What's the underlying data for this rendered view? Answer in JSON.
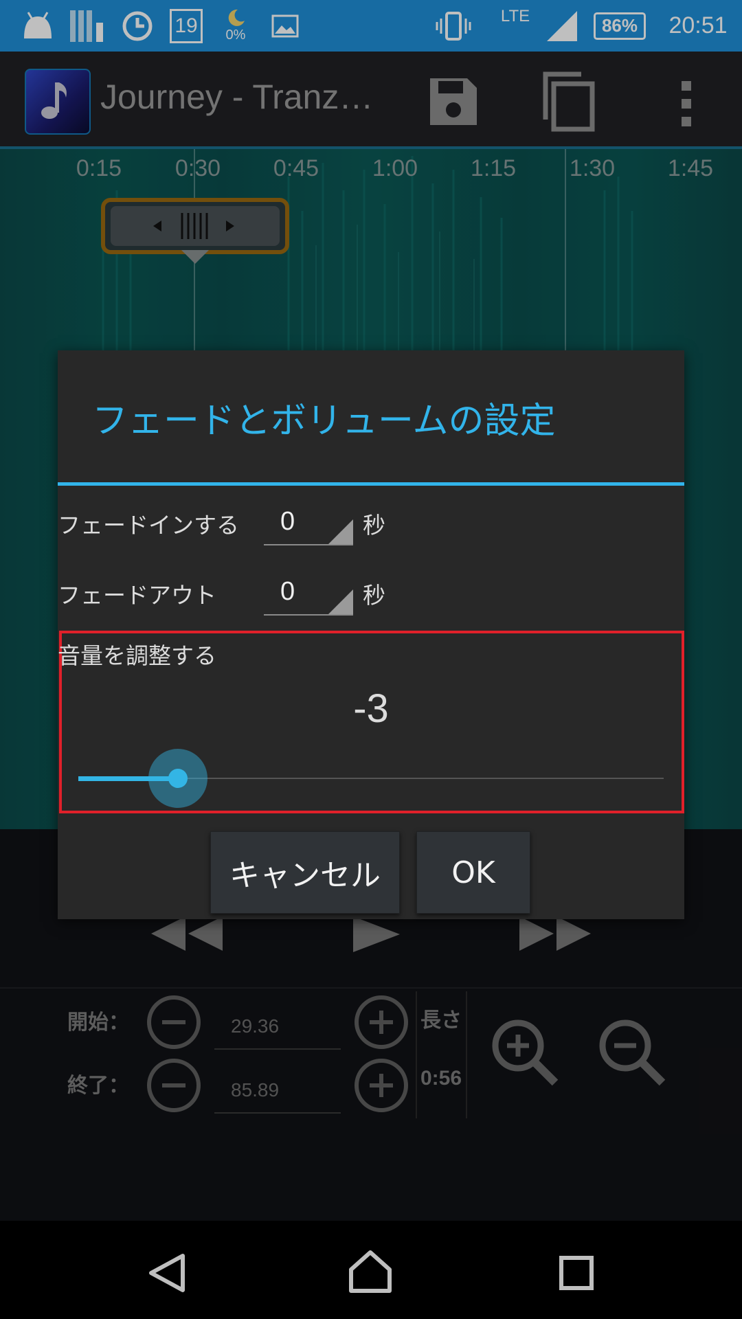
{
  "status_bar": {
    "calendar_day": "19",
    "moon_percent": "0%",
    "network": "LTE",
    "battery": "86%",
    "time": "20:51",
    "icons": [
      "android-icon",
      "storage-icon",
      "clock-icon",
      "calendar-icon",
      "moon-icon",
      "image-icon",
      "vibrate-icon",
      "signal-icon",
      "battery-icon"
    ]
  },
  "app_bar": {
    "title": "Journey - Tranz…",
    "icons": [
      "music-note-icon",
      "save-icon",
      "copy-icon",
      "overflow-menu-icon"
    ]
  },
  "timeline": {
    "ticks": [
      "0:15",
      "0:30",
      "0:45",
      "1:00",
      "1:15",
      "1:30",
      "1:45"
    ]
  },
  "dialog": {
    "title": "フェードとボリュームの設定",
    "fade_in_label": "フェードインする",
    "fade_in_value": "0",
    "fade_out_label": "フェードアウト",
    "fade_out_value": "0",
    "unit": "秒",
    "volume_label": "音量を調整する",
    "volume_value": "-3",
    "volume_slider_fraction": 0.17,
    "cancel_label": "キャンセル",
    "ok_label": "OK",
    "accent_color": "#33b5e5",
    "highlight_color": "#e0202a"
  },
  "controls": {
    "start_label": "開始：",
    "start_value": "29.36",
    "end_label": "終了：",
    "end_value": "85.89",
    "length_label": "長さ",
    "length_value": "0:56",
    "icons": [
      "rewind-icon",
      "play-icon",
      "fast-forward-icon",
      "zoom-in-icon",
      "zoom-out-icon",
      "minus-icon",
      "plus-icon"
    ]
  },
  "nav_bar": {
    "icons": [
      "back-icon",
      "home-icon",
      "recents-icon"
    ]
  }
}
